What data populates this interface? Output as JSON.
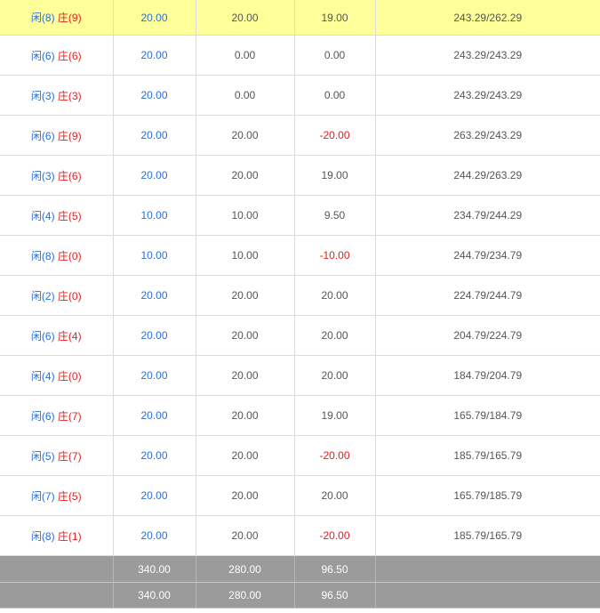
{
  "rows": [
    {
      "player": "闲(8)",
      "banker": "庄(9)",
      "bet": "20.00",
      "valid": "20.00",
      "result": "19.00",
      "result_neg": false,
      "balance": "243.29/262.29",
      "highlight": true
    },
    {
      "player": "闲(6)",
      "banker": "庄(6)",
      "bet": "20.00",
      "valid": "0.00",
      "result": "0.00",
      "result_neg": false,
      "balance": "243.29/243.29"
    },
    {
      "player": "闲(3)",
      "banker": "庄(3)",
      "bet": "20.00",
      "valid": "0.00",
      "result": "0.00",
      "result_neg": false,
      "balance": "243.29/243.29"
    },
    {
      "player": "闲(6)",
      "banker": "庄(9)",
      "bet": "20.00",
      "valid": "20.00",
      "result": "-20.00",
      "result_neg": true,
      "balance": "263.29/243.29"
    },
    {
      "player": "闲(3)",
      "banker": "庄(6)",
      "bet": "20.00",
      "valid": "20.00",
      "result": "19.00",
      "result_neg": false,
      "balance": "244.29/263.29"
    },
    {
      "player": "闲(4)",
      "banker": "庄(5)",
      "bet": "10.00",
      "valid": "10.00",
      "result": "9.50",
      "result_neg": false,
      "balance": "234.79/244.29"
    },
    {
      "player": "闲(8)",
      "banker": "庄(0)",
      "bet": "10.00",
      "valid": "10.00",
      "result": "-10.00",
      "result_neg": true,
      "balance": "244.79/234.79"
    },
    {
      "player": "闲(2)",
      "banker": "庄(0)",
      "bet": "20.00",
      "valid": "20.00",
      "result": "20.00",
      "result_neg": false,
      "balance": "224.79/244.79"
    },
    {
      "player": "闲(6)",
      "banker": "庄(4)",
      "bet": "20.00",
      "valid": "20.00",
      "result": "20.00",
      "result_neg": false,
      "balance": "204.79/224.79"
    },
    {
      "player": "闲(4)",
      "banker": "庄(0)",
      "bet": "20.00",
      "valid": "20.00",
      "result": "20.00",
      "result_neg": false,
      "balance": "184.79/204.79"
    },
    {
      "player": "闲(6)",
      "banker": "庄(7)",
      "bet": "20.00",
      "valid": "20.00",
      "result": "19.00",
      "result_neg": false,
      "balance": "165.79/184.79"
    },
    {
      "player": "闲(5)",
      "banker": "庄(7)",
      "bet": "20.00",
      "valid": "20.00",
      "result": "-20.00",
      "result_neg": true,
      "balance": "185.79/165.79"
    },
    {
      "player": "闲(7)",
      "banker": "庄(5)",
      "bet": "20.00",
      "valid": "20.00",
      "result": "20.00",
      "result_neg": false,
      "balance": "165.79/185.79"
    },
    {
      "player": "闲(8)",
      "banker": "庄(1)",
      "bet": "20.00",
      "valid": "20.00",
      "result": "-20.00",
      "result_neg": true,
      "balance": "185.79/165.79"
    }
  ],
  "totals": [
    {
      "bet": "340.00",
      "valid": "280.00",
      "result": "96.50"
    },
    {
      "bet": "340.00",
      "valid": "280.00",
      "result": "96.50"
    }
  ],
  "colors": {
    "player": "#2b6fd6",
    "banker": "#e02020",
    "highlight": "#ffff99",
    "total_bg": "#9b9b9b"
  }
}
